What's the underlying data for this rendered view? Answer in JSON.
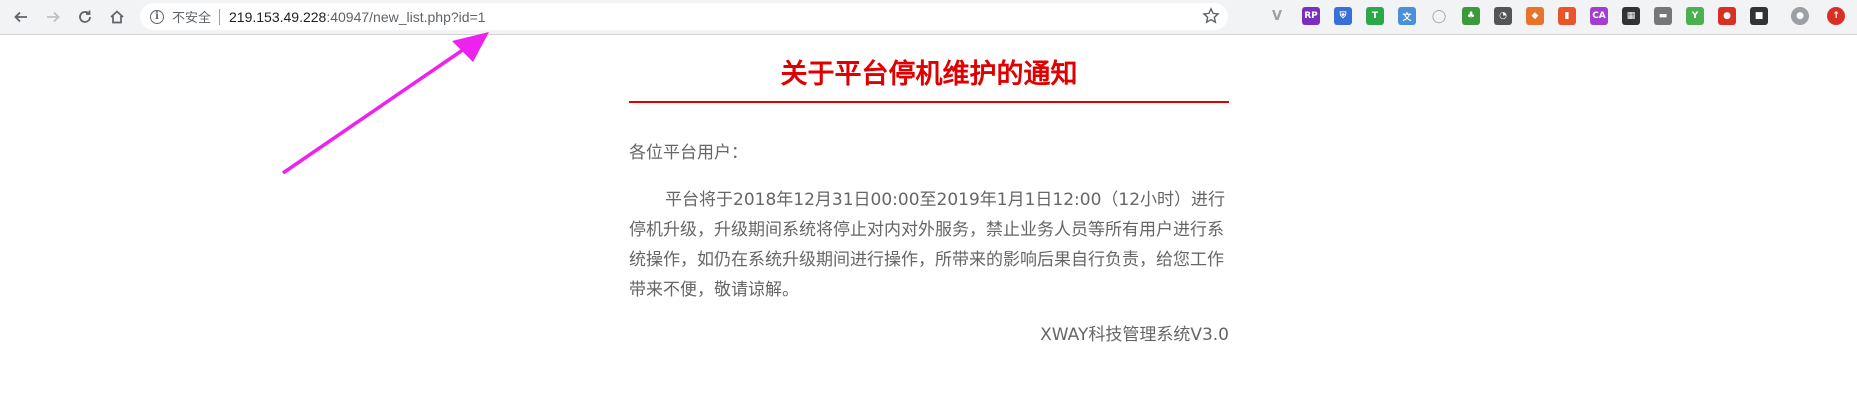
{
  "browser": {
    "security_label": "不安全",
    "url_host": "219.153.49.228",
    "url_rest": ":40947/new_list.php?id=1",
    "extensions": [
      {
        "name": "vue-devtools-icon",
        "glyph": "V",
        "color": "#9aa0a6"
      },
      {
        "name": "rp-extension-icon",
        "glyph": "RP",
        "color": "#7b2fbf"
      },
      {
        "name": "shield-extension-icon",
        "glyph": "⛨",
        "color": "#3a6fd8"
      },
      {
        "name": "t-extension-icon",
        "glyph": "T",
        "color": "#2aa84a"
      },
      {
        "name": "translate-extension-icon",
        "glyph": "文",
        "color": "#4a90d9"
      },
      {
        "name": "circle-extension-icon",
        "glyph": "◯",
        "color": "#9aa0a6"
      },
      {
        "name": "green-extension-icon",
        "glyph": "♣",
        "color": "#3c9a3c"
      },
      {
        "name": "clock-extension-icon",
        "glyph": "◔",
        "color": "#555555"
      },
      {
        "name": "fox-extension-icon",
        "glyph": "◆",
        "color": "#e8742b"
      },
      {
        "name": "orange-extension-icon",
        "glyph": "▮",
        "color": "#e8552b"
      },
      {
        "name": "ca-extension-icon",
        "glyph": "CA",
        "color": "#a23fd0"
      },
      {
        "name": "grid-extension-icon",
        "glyph": "▦",
        "color": "#333333"
      },
      {
        "name": "panel-extension-icon",
        "glyph": "▬",
        "color": "#777777"
      },
      {
        "name": "y-extension-icon",
        "glyph": "Y",
        "color": "#4caf50"
      },
      {
        "name": "santa-extension-icon",
        "glyph": "●",
        "color": "#d93025"
      },
      {
        "name": "mask-extension-icon",
        "glyph": "■",
        "color": "#333333"
      },
      {
        "name": "profile-avatar-icon",
        "glyph": "●",
        "color": "#9aa0a6"
      },
      {
        "name": "update-icon",
        "glyph": "↑",
        "color": "#d93025"
      }
    ]
  },
  "notice": {
    "title": "关于平台停机维护的通知",
    "greeting": "各位平台用户：",
    "body": "平台将于2018年12月31日00:00至2019年1月1日12:00（12小时）进行停机升级，升级期间系统将停止对内对外服务，禁止业务人员等所有用户进行系统操作，如仍在系统升级期间进行操作，所带来的影响后果自行负责，给您工作带来不便，敬请谅解。",
    "signature": "XWAY科技管理系统V3.0"
  },
  "colors": {
    "title_red": "#e00000",
    "text_gray": "#666666",
    "annotation_magenta": "#ee22ee"
  }
}
